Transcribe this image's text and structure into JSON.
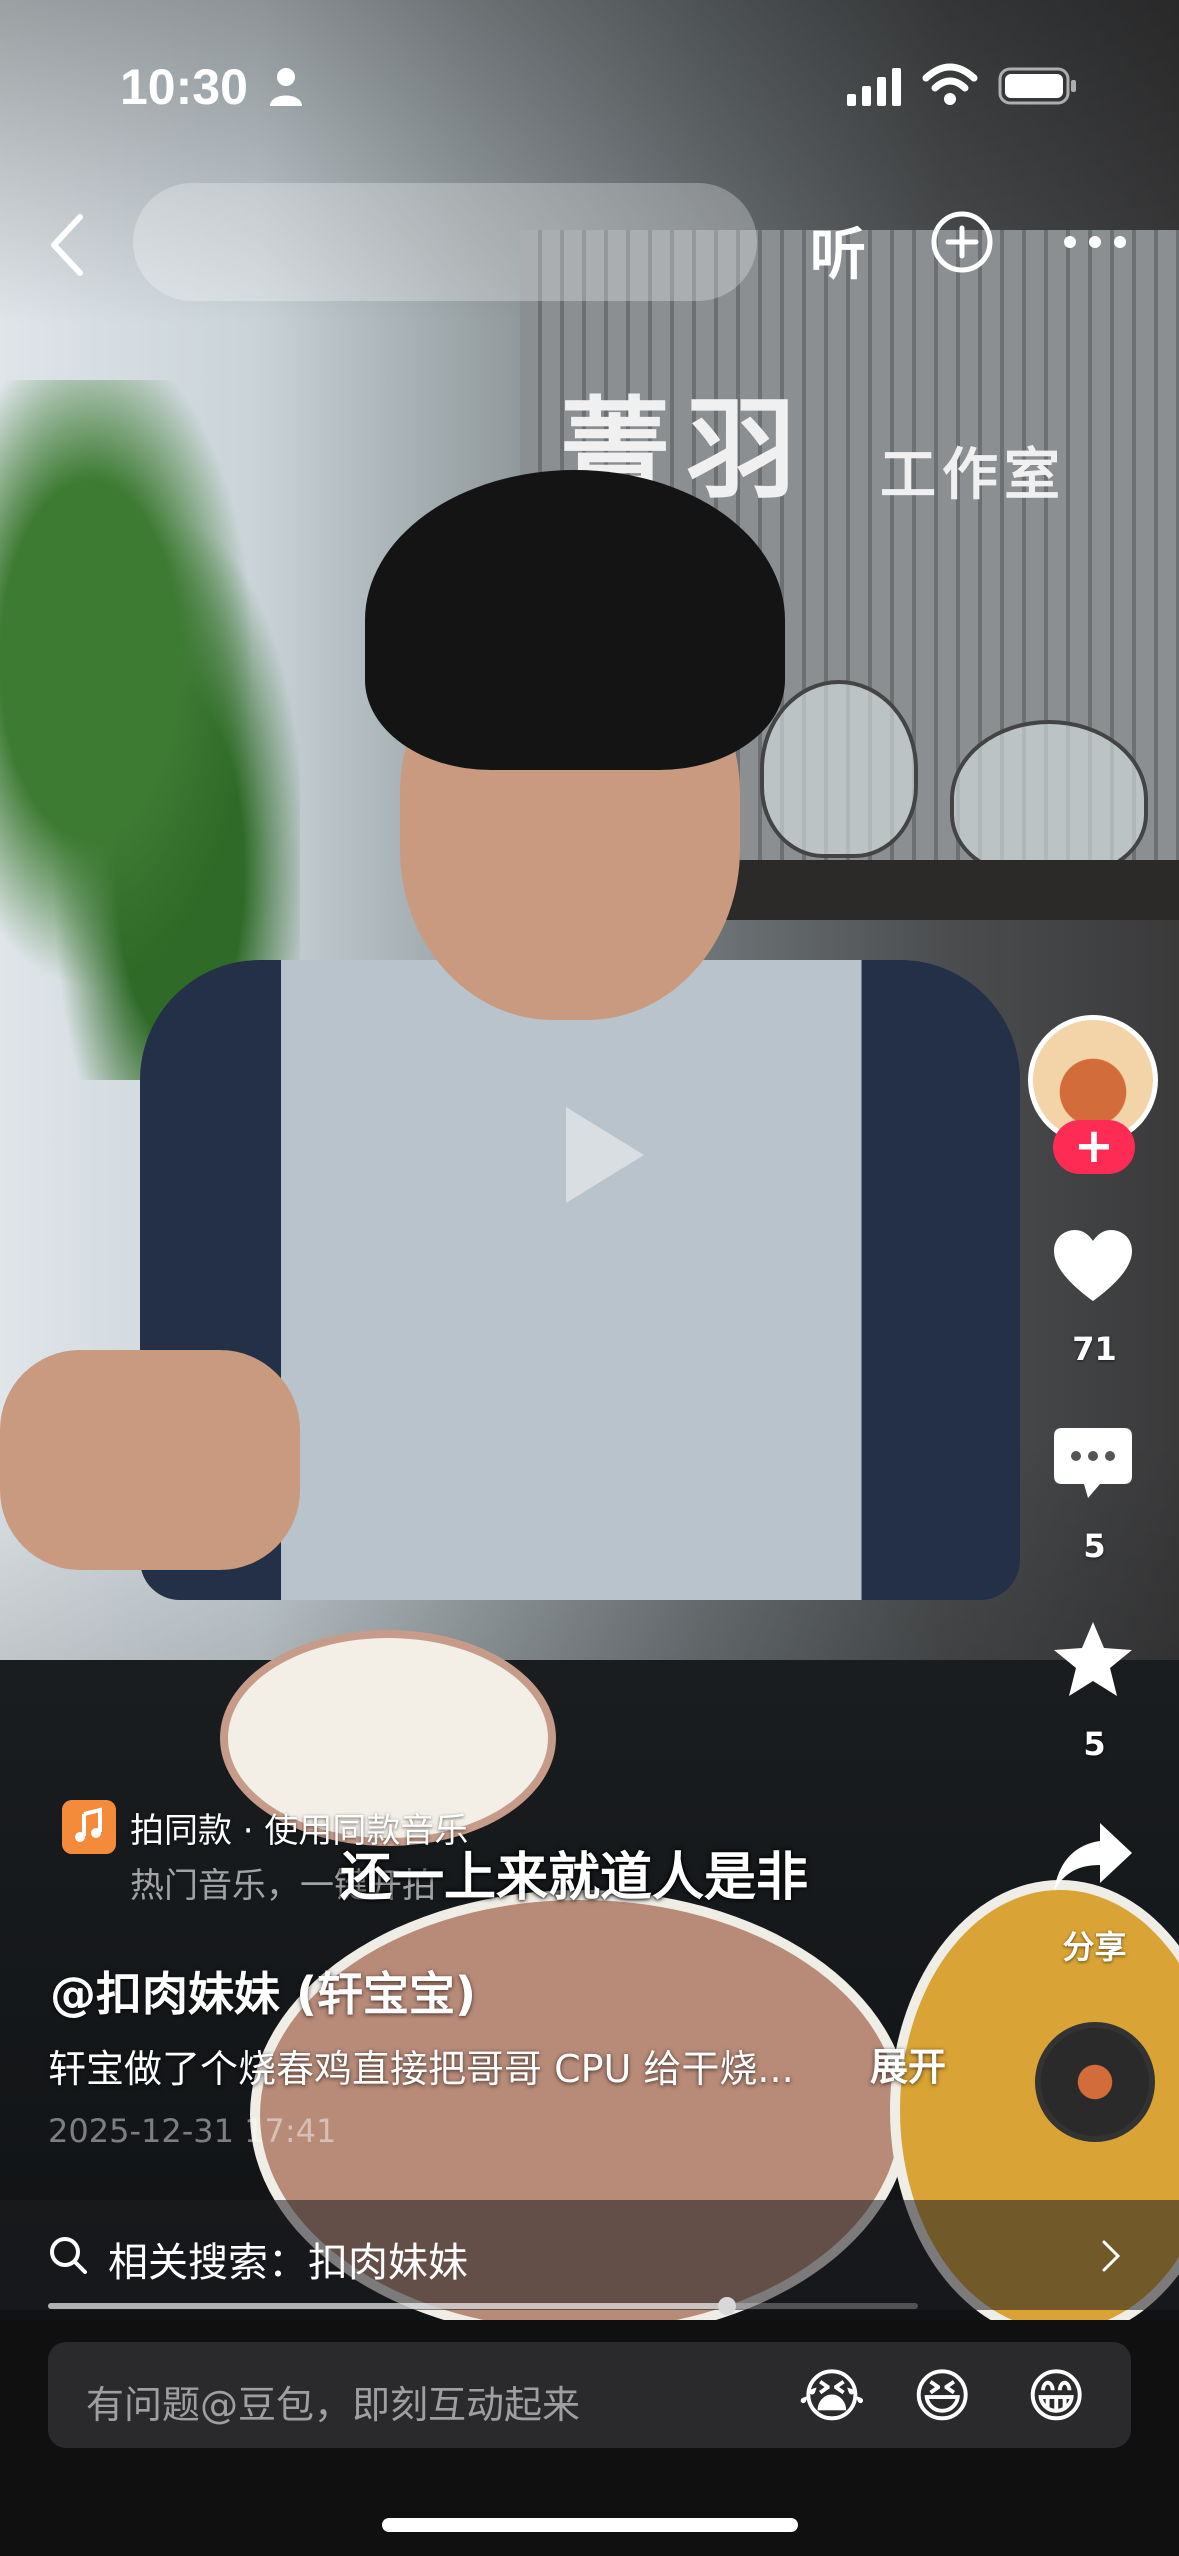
{
  "status_bar": {
    "time": "10:30"
  },
  "top_bar": {
    "search_placeholder": "",
    "listen_label": "听"
  },
  "video": {
    "subtitle": "还一上来就道人是非",
    "wall_sign_large": "菁羽",
    "wall_sign_small": "工作室"
  },
  "right_rail": {
    "follow_label": "+",
    "likes": "71",
    "comments": "5",
    "favorites": "5",
    "share_label": "分享"
  },
  "music": {
    "title": "拍同款 · 使用同款音乐",
    "subtitle": "热门音乐，一键开拍"
  },
  "post": {
    "author": "@扣肉妹妹 (轩宝宝)",
    "description": "轩宝做了个烧春鸡直接把哥哥 CPU 给干烧...",
    "expand_label": "展开",
    "date": "2025-12-31 17:41"
  },
  "related_search": {
    "label": "相关搜索：扣肉妹妹"
  },
  "playback": {
    "progress": 0.78
  },
  "comment_bar": {
    "placeholder": "有问题@豆包，即刻互动起来",
    "emojis": [
      "😭",
      "😆",
      "😁"
    ]
  },
  "colors": {
    "accent": "#fe2c55",
    "music_badge": "#f48b3a"
  }
}
